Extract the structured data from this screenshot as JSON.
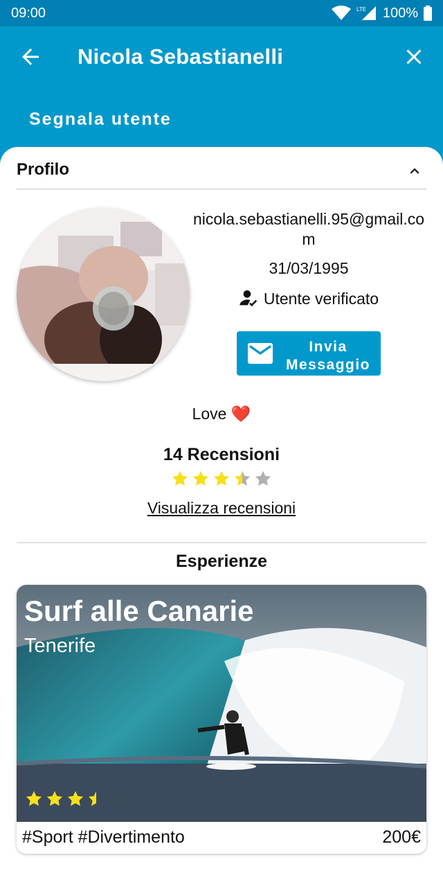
{
  "status_bar": {
    "time": "09:00",
    "network": "LTE",
    "battery": "100%"
  },
  "app_bar": {
    "title": "Nicola Sebastianelli",
    "report_action": "Segnala utente"
  },
  "profile_section": {
    "header": "Profilo",
    "email": "nicola.sebastianelli.95@gmail.com",
    "birth_date": "31/03/1995",
    "verified_label": "Utente verificato",
    "message_button": "Invia Messaggio",
    "bio": "Love ❤️",
    "reviews_count_label": "14 Recensioni",
    "rating": 3.5,
    "rating_max": 5,
    "view_reviews_link": "Visualizza recensioni"
  },
  "experiences": {
    "header": "Esperienze",
    "items": [
      {
        "title": "Surf alle Canarie",
        "location": "Tenerife",
        "rating": 3.5,
        "rating_max": 5,
        "tags": "#Sport #Divertimento",
        "price": "200€"
      }
    ]
  },
  "colors": {
    "primary": "#0199cc",
    "status_bar": "#0180b5",
    "star": "#f7e01b",
    "star_empty": "#b0b0b0"
  },
  "icons": [
    "back-arrow-icon",
    "close-icon",
    "chevron-up-icon",
    "verified-user-icon",
    "mail-icon",
    "star-icon"
  ]
}
